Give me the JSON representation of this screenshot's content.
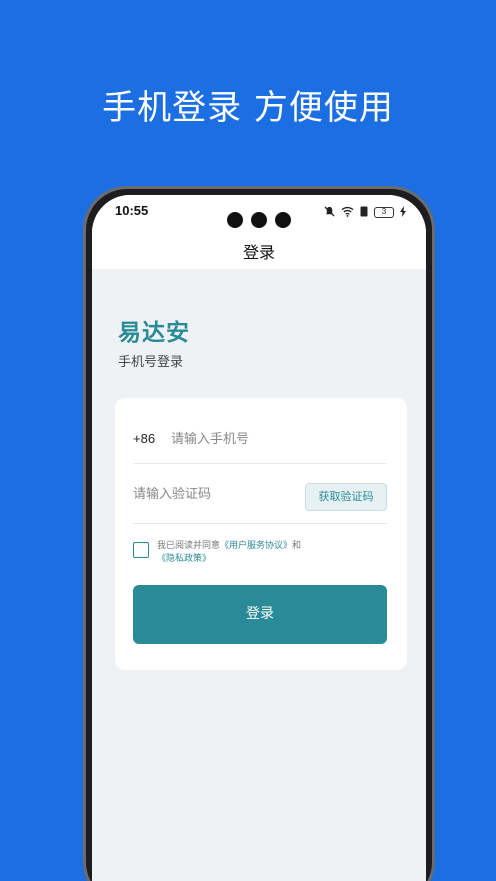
{
  "headline": "手机登录 方便使用",
  "status_bar": {
    "time": "10:55",
    "battery": "3"
  },
  "screen_title": "登录",
  "brand": "易达安",
  "subtitle": "手机号登录",
  "form": {
    "country_code": "+86",
    "phone_placeholder": "请输入手机号",
    "code_placeholder": "请输入验证码",
    "get_code_label": "获取验证码",
    "agreement_prefix": "我已阅读并同意",
    "terms_link": "《用户服务协议》",
    "and_text": "和",
    "privacy_link": "《隐私政策》",
    "login_label": "登录"
  },
  "colors": {
    "background": "#1b6fe3",
    "accent": "#2a8a98"
  }
}
